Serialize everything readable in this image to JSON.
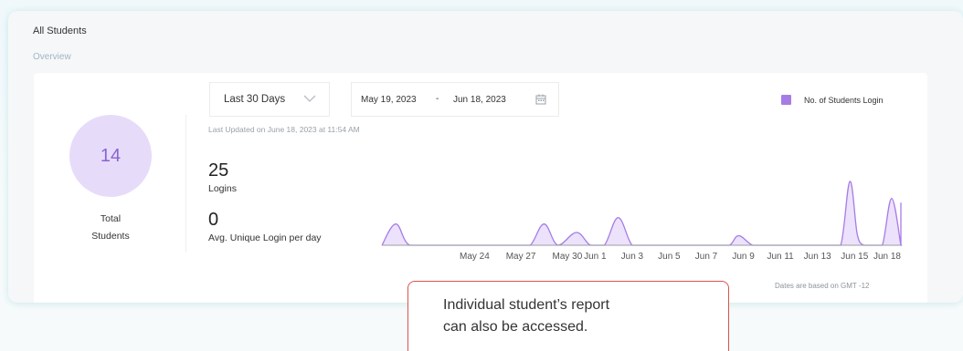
{
  "header": {
    "title": "All Students",
    "tab": "Overview"
  },
  "summary": {
    "total_value": "14",
    "total_label_1": "Total",
    "total_label_2": "Students"
  },
  "filters": {
    "range_label": "Last 30 Days",
    "start_date": "May 19, 2023",
    "separator": "-",
    "end_date": "Jun 18, 2023",
    "calendar_icon": "calendar-icon",
    "chevron_icon": "chevron-down-icon"
  },
  "last_updated": "Last Updated on June 18, 2023 at 11:54 AM",
  "stats": {
    "logins_value": "25",
    "logins_label": "Logins",
    "avg_value": "0",
    "avg_label": "Avg. Unique Login per day"
  },
  "legend": {
    "label": "No. of Students Login",
    "color": "#a77be6"
  },
  "chart_data": {
    "type": "area",
    "series": [
      {
        "name": "No. of Students Login",
        "values": [
          0,
          1,
          0,
          0,
          0,
          0,
          0,
          0,
          0,
          1,
          0,
          0.6,
          0,
          0,
          1.3,
          0,
          0,
          0,
          0,
          0,
          0,
          0,
          0,
          0.45,
          0,
          0,
          0,
          0,
          0,
          0,
          0,
          0,
          3,
          0.5,
          0,
          0,
          0,
          2.2,
          0,
          0,
          2,
          0
        ]
      }
    ],
    "ticks": [
      "May 24",
      "May 27",
      "May 30",
      "Jun 1",
      "Jun 3",
      "Jun 5",
      "Jun 7",
      "Jun 9",
      "Jun 11",
      "Jun 13",
      "Jun 15",
      "Jun 18"
    ],
    "tick_index": [
      10,
      15,
      20,
      23,
      27,
      31,
      35,
      39,
      43,
      47,
      51,
      56
    ],
    "n_points": 57,
    "grid": false,
    "legend_position": "top-right",
    "fill_color": "#ece2fb",
    "line_color": "#a77be6"
  },
  "footnote": "Dates are based on GMT -12",
  "callout": {
    "line1": "Individual student’s report",
    "line2": "can also be accessed."
  }
}
